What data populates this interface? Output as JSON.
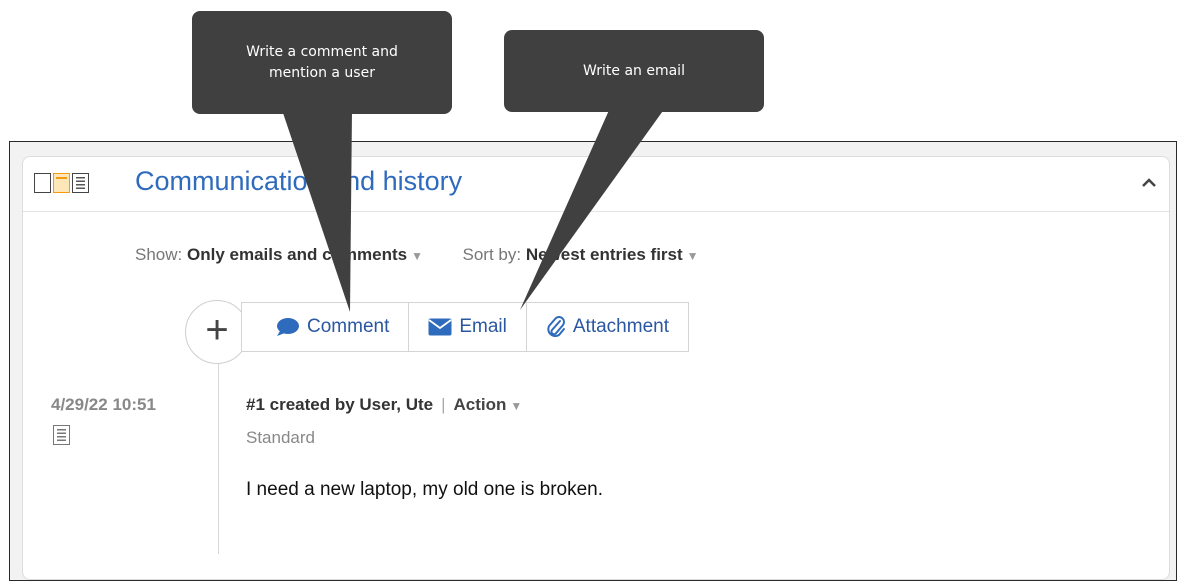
{
  "panel": {
    "title": "Communication and history",
    "layout_icons": [
      "single-column-icon",
      "two-column-icon",
      "detail-list-icon"
    ],
    "accent_color": "#2f6bbd",
    "collapse_icon": "chevron-up-icon"
  },
  "filters": {
    "show_label": "Show:",
    "show_value": "Only emails and comments",
    "sort_label": "Sort by:",
    "sort_value": "Newest entries first"
  },
  "actions": {
    "add_icon": "plus-icon",
    "buttons": [
      {
        "label": "Comment",
        "icon": "speech-bubble-icon"
      },
      {
        "label": "Email",
        "icon": "envelope-icon"
      },
      {
        "label": "Attachment",
        "icon": "paperclip-icon"
      }
    ]
  },
  "entry": {
    "date": "4/29/22 10:51",
    "created": "#1 created by User, Ute",
    "separator": "|",
    "action_label": "Action",
    "type": "Standard",
    "body": "I need a new laptop, my old one is broken."
  },
  "callouts": {
    "comment_line1": "Write a comment and",
    "comment_line2": "mention a user",
    "email": "Write an email",
    "color": "#404040"
  }
}
